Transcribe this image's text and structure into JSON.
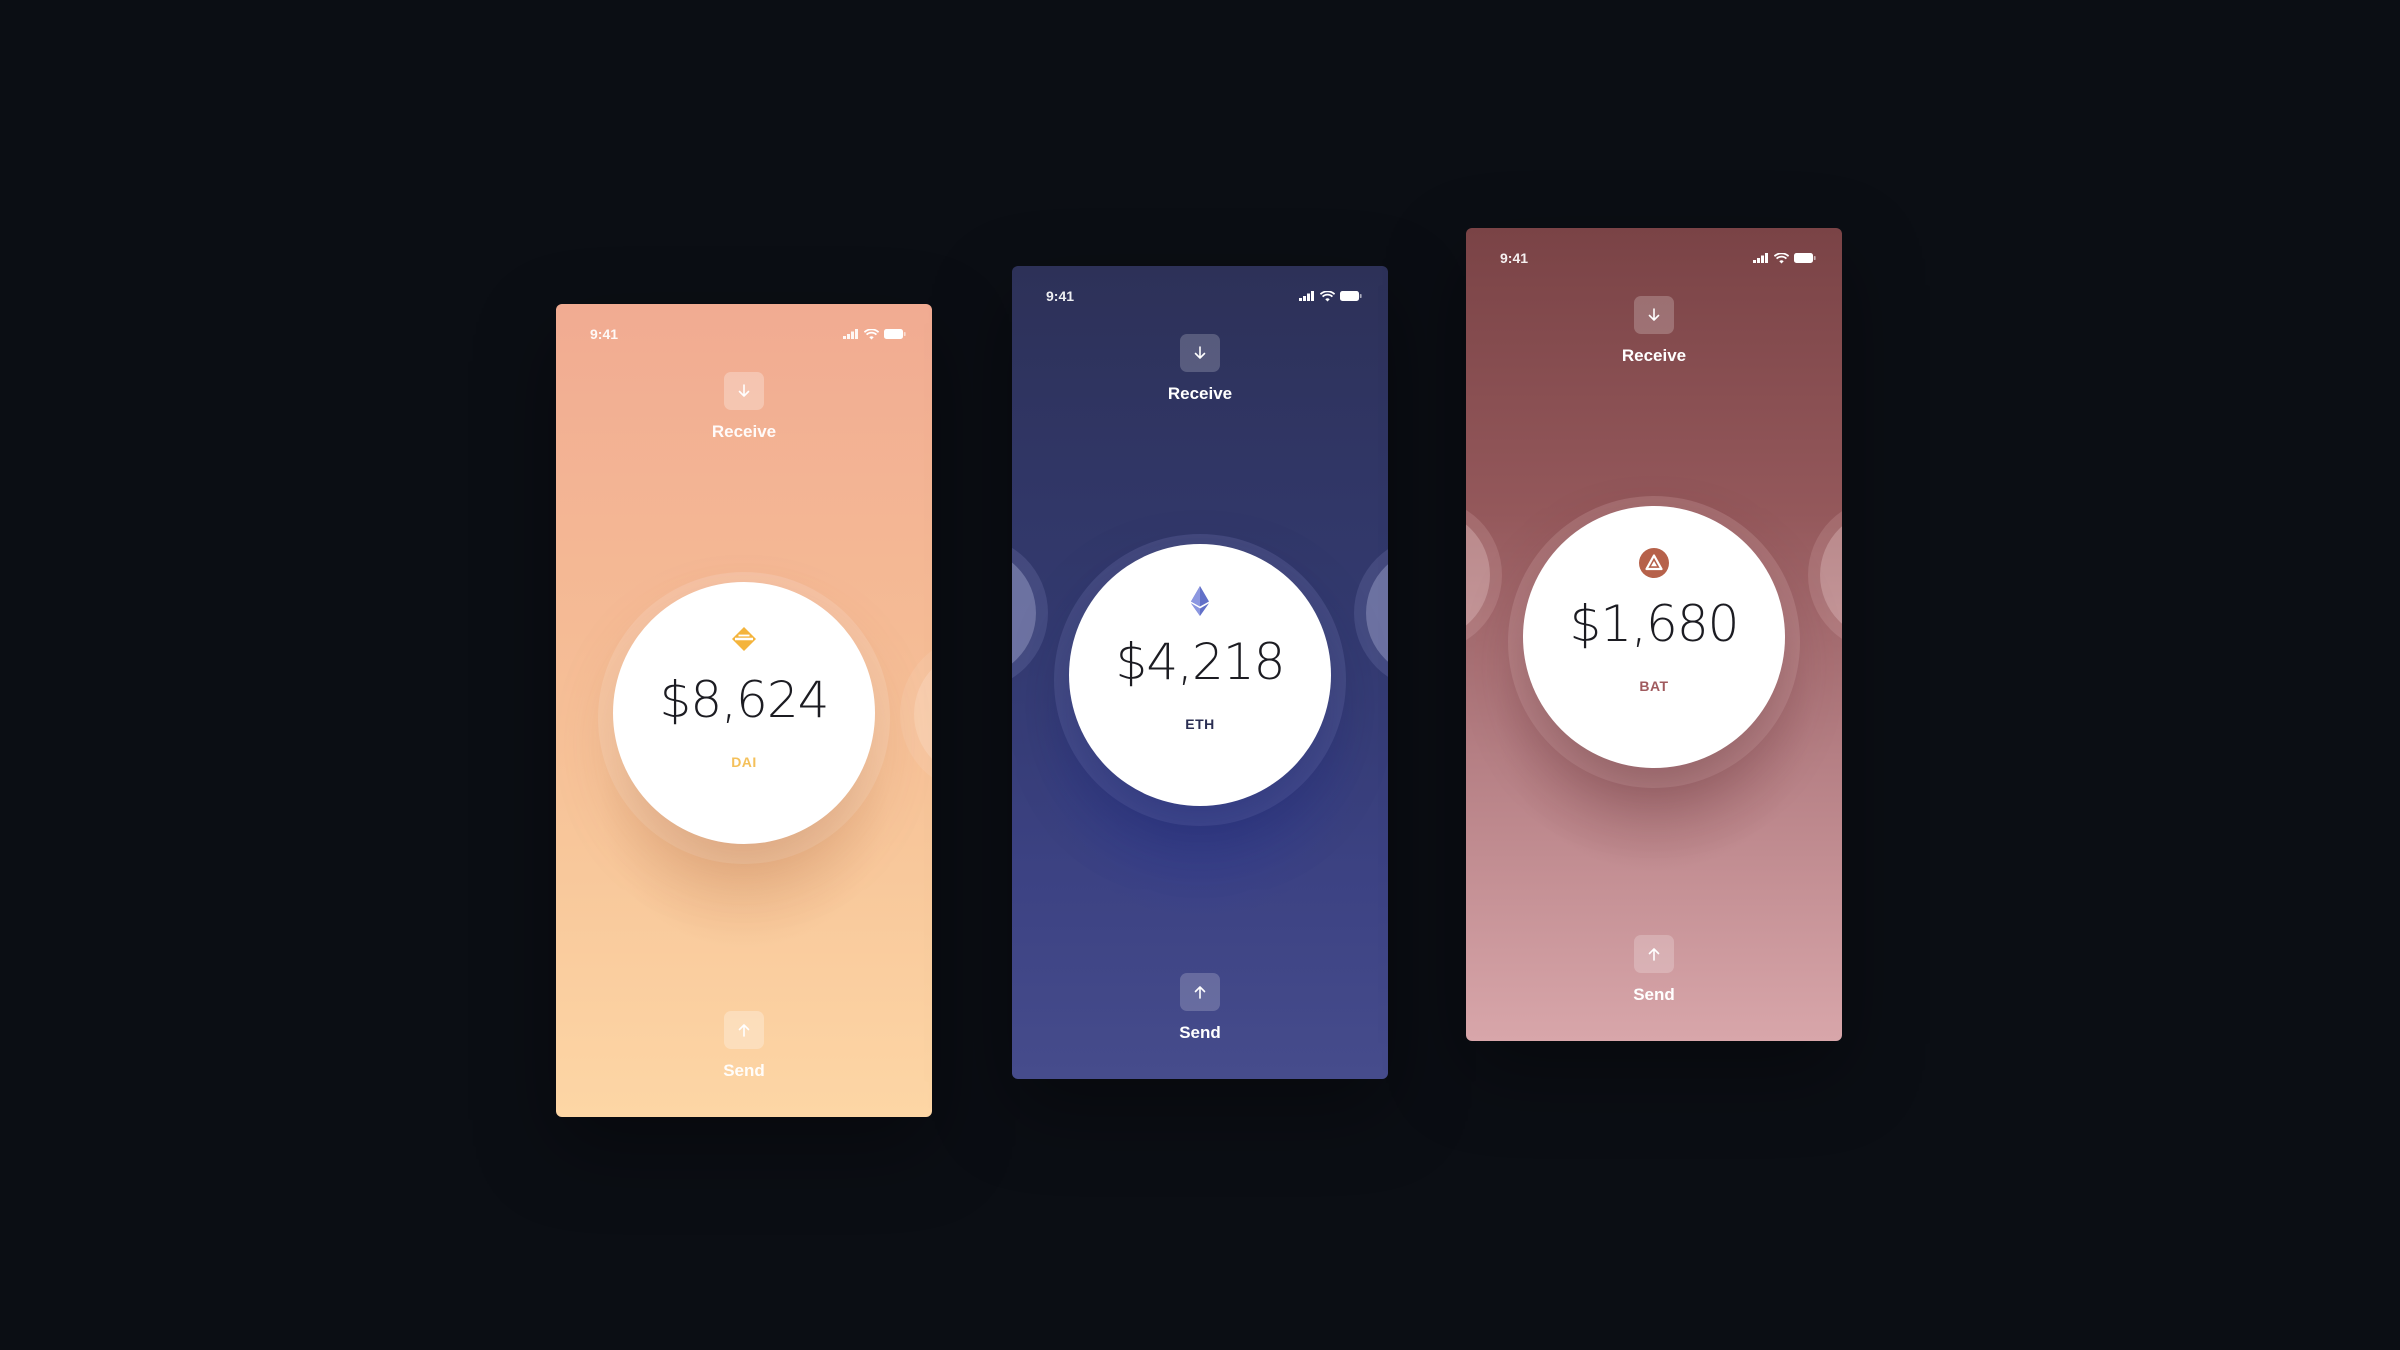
{
  "wallets": [
    {
      "id": "dai",
      "status_time": "9:41",
      "receive_label": "Receive",
      "send_label": "Send",
      "amount": "$8,624",
      "symbol": "DAI",
      "icon": "dai-diamond-icon",
      "accent_color": "#f4b43c",
      "symbol_color": "#f4c05a"
    },
    {
      "id": "eth",
      "status_time": "9:41",
      "receive_label": "Receive",
      "send_label": "Send",
      "amount": "$4,218",
      "symbol": "ETH",
      "icon": "ethereum-icon",
      "accent_color": "#6270c8",
      "symbol_color": "#2a2e52"
    },
    {
      "id": "bat",
      "status_time": "9:41",
      "receive_label": "Receive",
      "send_label": "Send",
      "amount": "$1,680",
      "symbol": "BAT",
      "icon": "bat-triangle-icon",
      "accent_color": "#b6614a",
      "symbol_color": "#a05a5e"
    }
  ]
}
